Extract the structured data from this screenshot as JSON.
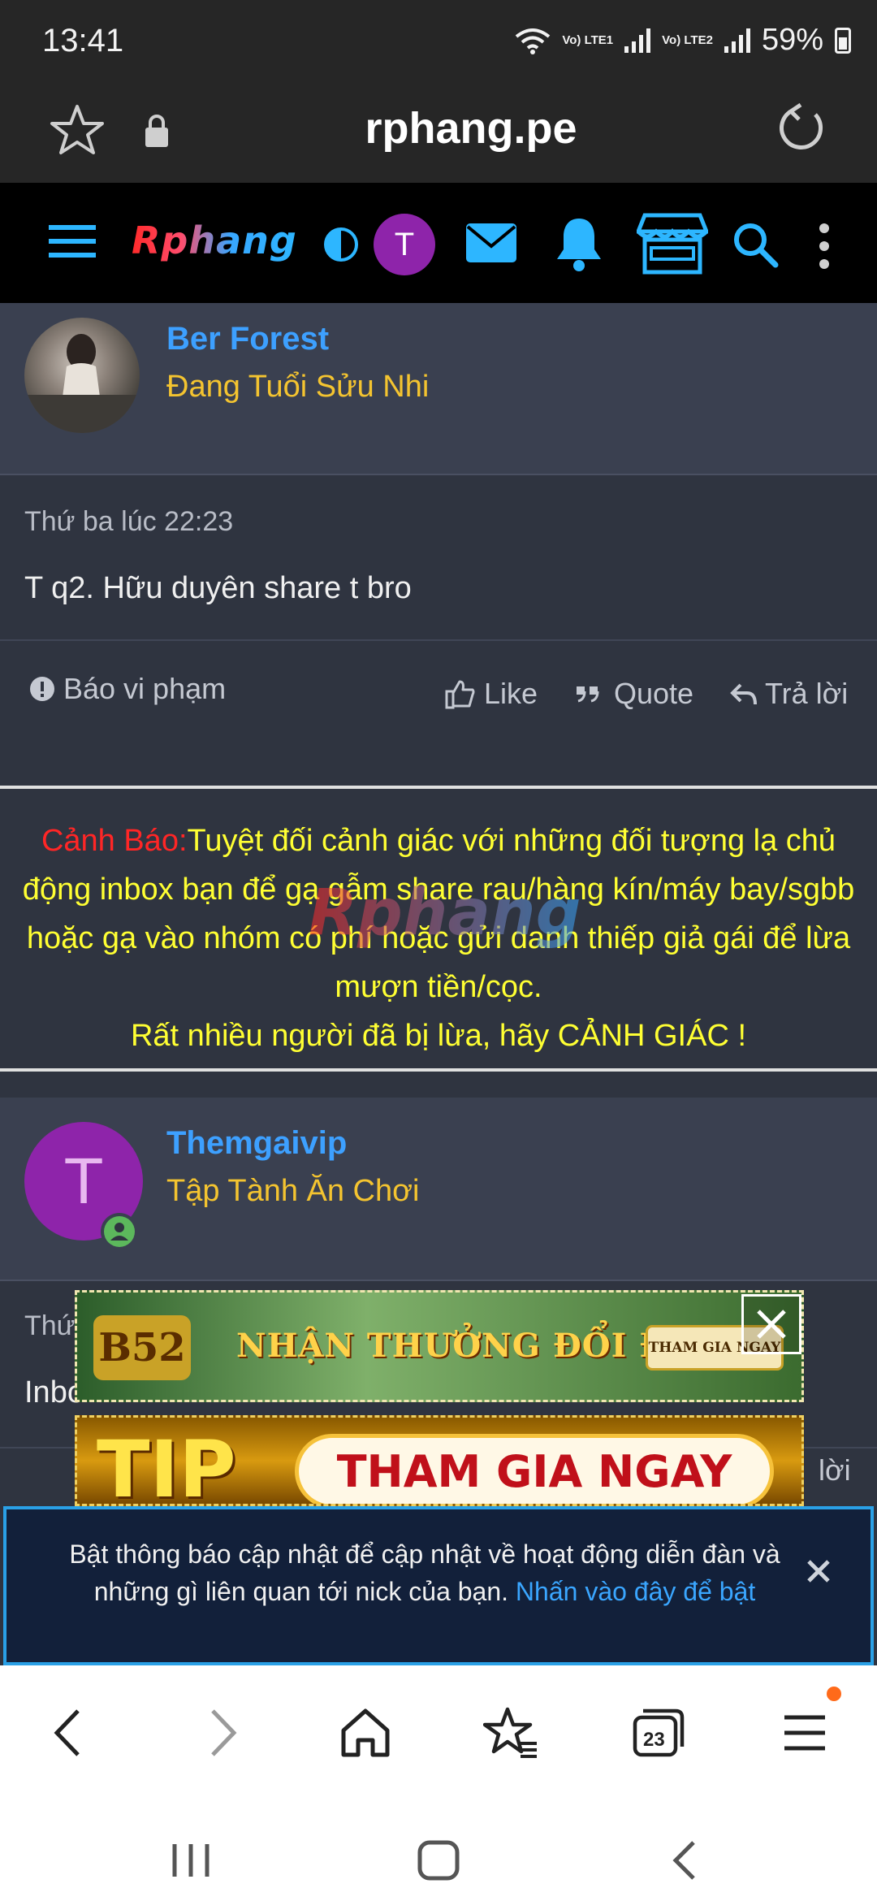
{
  "status": {
    "time": "13:41",
    "lte1": "Vo) LTE1",
    "lte2": "Vo) LTE2",
    "battery": "59%"
  },
  "browser": {
    "domain": "rphang.pe",
    "tab_count": "23"
  },
  "forum": {
    "logo": "Rphang",
    "user_initial": "T",
    "watermark": "Rphang"
  },
  "post1": {
    "username": "Ber Forest",
    "user_title": "Đang Tuổi Sửu Nhi",
    "date": "Thứ ba lúc 22:23",
    "message": "T q2. Hữu duyên share t bro",
    "report": "Báo vi phạm",
    "like": "Like",
    "quote": "Quote",
    "reply": "Trả lời"
  },
  "warning": {
    "label": "Cảnh Báo:",
    "text": "Tuyệt đối cảnh giác với những đối tượng lạ chủ động inbox bạn để gạ gẫm share rau/hàng kín/máy bay/sgbb hoặc gạ vào nhóm có phí hoặc gửi danh thiếp giả gái để lừa mượn tiền/cọc.",
    "line2": "Rất nhiều người đã bị lừa, hãy CẢNH GIÁC !"
  },
  "post2": {
    "avatar_letter": "T",
    "username": "Themgaivip",
    "user_title": "Tập Tành Ăn Chơi",
    "date_partial": "Thứ",
    "message_partial": "Inbox",
    "reply_partial": "lời"
  },
  "ads": {
    "ad1_brand": "B52",
    "ad1_text": "NHẬN THƯỞNG ĐỔI ĐỜI",
    "ad1_button": "THAM GIA NGAY",
    "ad2_brand": "TIP",
    "ad2_button": "THAM GIA NGAY"
  },
  "notification": {
    "text": "Bật thông báo cập nhật để cập nhật về hoạt động diễn đàn và những gì liên quan tới nick của bạn.",
    "link": "Nhấn vào đây để bật"
  },
  "colors": {
    "username": "#3da0ff",
    "title": "#f4c430",
    "warning": "#ffff33",
    "warning_label": "#ff2626",
    "accent": "#2aa0e6"
  }
}
